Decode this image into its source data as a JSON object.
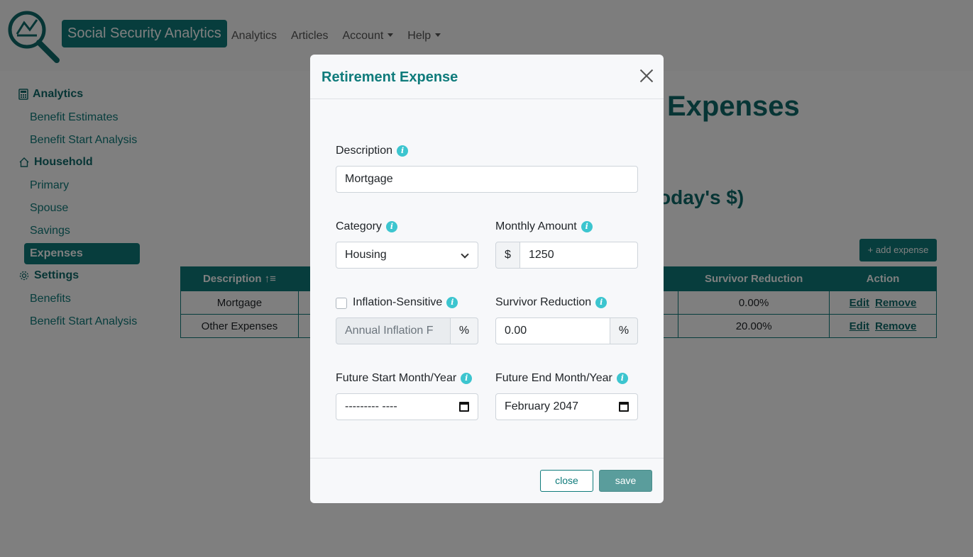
{
  "header": {
    "brand": "Social Security Analytics",
    "nav": [
      "Analytics",
      "Articles",
      "Account",
      "Help"
    ]
  },
  "sidebar": {
    "groups": [
      {
        "label": "Analytics",
        "icon": "calculator-icon",
        "items": [
          "Benefit Estimates",
          "Benefit Start Analysis"
        ]
      },
      {
        "label": "Household",
        "icon": "house-icon",
        "items": [
          "Primary",
          "Spouse",
          "Savings",
          "Expenses"
        ]
      },
      {
        "label": "Settings",
        "icon": "gear-icon",
        "items": [
          "Benefits",
          "Benefit Start Analysis"
        ]
      }
    ],
    "active": "Expenses"
  },
  "main": {
    "title_fragment": "Expenses",
    "subtitle_fragment": "oday's $)",
    "add_button": "+ add expense",
    "table": {
      "columns": [
        "Description ↑≡",
        "Survivor Reduction",
        "Action"
      ],
      "rows": [
        {
          "description": "Mortgage",
          "survivor_reduction": "0.00%",
          "edit": "Edit",
          "remove": "Remove"
        },
        {
          "description": "Other Expenses",
          "survivor_reduction": "20.00%",
          "edit": "Edit",
          "remove": "Remove"
        }
      ]
    }
  },
  "modal": {
    "title": "Retirement Expense",
    "description_label": "Description",
    "description_value": "Mortgage",
    "category_label": "Category",
    "category_value": "Housing",
    "monthly_amount_label": "Monthly Amount",
    "currency_symbol": "$",
    "monthly_amount_value": "1250",
    "inflation_label": "Inflation-Sensitive",
    "inflation_checked": false,
    "inflation_placeholder": "Annual Inflation F",
    "percent_symbol": "%",
    "survivor_label": "Survivor Reduction",
    "survivor_value": "0.00",
    "start_label": "Future Start Month/Year",
    "start_value": "--------- ----",
    "end_label": "Future End Month/Year",
    "end_value": "February 2047",
    "close_label": "close",
    "save_label": "save"
  },
  "colors": {
    "primary": "#0f7b7b",
    "info": "#3cc5cf",
    "save": "#5a9d9c"
  }
}
